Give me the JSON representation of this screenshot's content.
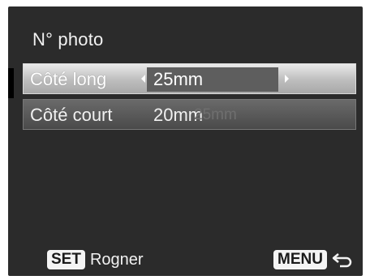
{
  "screen": {
    "title": "N° photo"
  },
  "settings": {
    "rows": [
      {
        "label": "Côté long",
        "value": "25mm"
      },
      {
        "label": "Côté court",
        "value": "20mm",
        "secondary_value": "25mm"
      }
    ]
  },
  "footer": {
    "set_key": "SET",
    "set_label": "Rogner",
    "menu_key": "MENU"
  },
  "colors": {
    "background": "#2b2b2b",
    "selected_row": "#bdbdbd",
    "row": "#5a5a5a"
  },
  "icons": {
    "left_arrow": "caret-left-icon",
    "right_arrow": "caret-right-icon",
    "return": "return-arrow-icon"
  }
}
